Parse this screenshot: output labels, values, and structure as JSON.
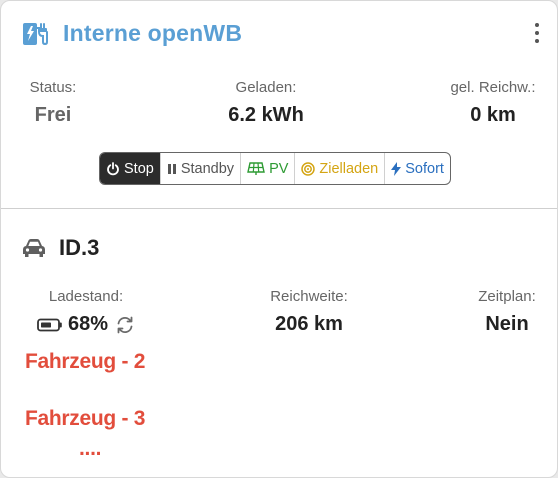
{
  "header": {
    "title": "Interne openWB",
    "icon": "charging-station-icon",
    "menu_icon": "kebab-menu-icon",
    "accent_color": "#5a9fd4"
  },
  "status": {
    "status_label": "Status:",
    "status_value": "Frei",
    "charged_label": "Geladen:",
    "charged_value": "6.2 kWh",
    "range_label": "gel. Reichw.:",
    "range_value": "0 km"
  },
  "modes": {
    "active": "Stop",
    "items": [
      {
        "label": "Stop",
        "icon": "power-icon"
      },
      {
        "label": "Standby",
        "icon": "pause-icon"
      },
      {
        "label": "PV",
        "icon": "solar-panel-icon"
      },
      {
        "label": "Zielladen",
        "icon": "target-icon"
      },
      {
        "label": "Sofort",
        "icon": "bolt-icon"
      }
    ]
  },
  "vehicle": {
    "name": "ID.3",
    "icon": "car-icon",
    "soc_label": "Ladestand:",
    "soc_value": "68%",
    "soc_level": 0.68,
    "range_label": "Reichweite:",
    "range_value": "206 km",
    "plan_label": "Zeitplan:",
    "plan_value": "Nein"
  },
  "overlays": {
    "vehicle2": "Fahrzeug - 2",
    "vehicle3": "Fahrzeug - 3",
    "more": "...."
  }
}
